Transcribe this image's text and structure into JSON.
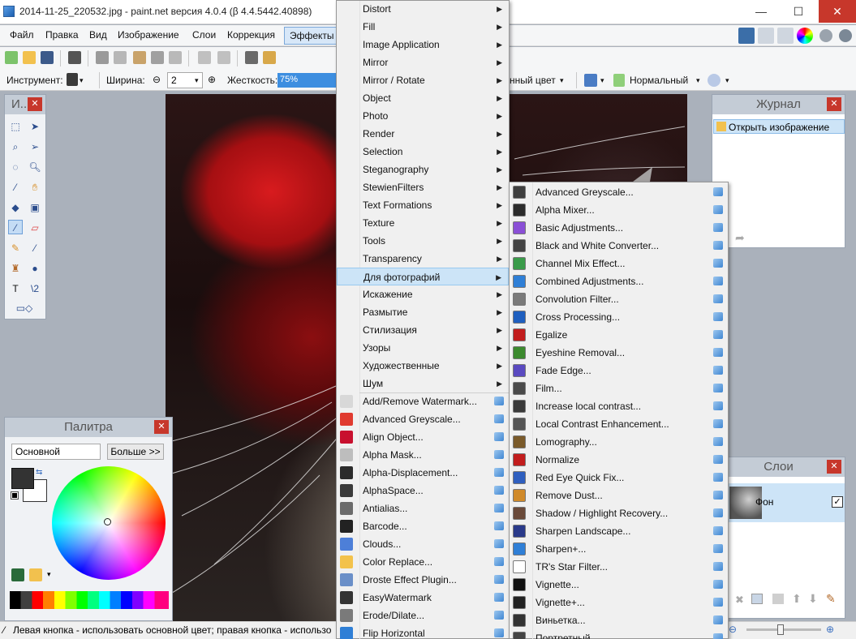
{
  "window": {
    "title": "2014-11-25_220532.jpg - paint.net версия 4.0.4 (β 4.4.5442.40898)",
    "min": "—",
    "max": "☐",
    "close": "✕"
  },
  "menubar": {
    "items": [
      "Файл",
      "Правка",
      "Вид",
      "Изображение",
      "Слои",
      "Коррекция",
      "Эффекты"
    ]
  },
  "options": {
    "instrument_label": "Инструмент:",
    "width_label": "Ширина:",
    "width_value": "2",
    "hardness_label": "Жесткость:",
    "hardness_value": "75%",
    "color_mode_tail": "нный цвет",
    "blend_mode": "Нормальный"
  },
  "tools_panel": {
    "title": "И..."
  },
  "palette_panel": {
    "title": "Палитра",
    "mode": "Основной",
    "more": "Больше >>"
  },
  "journal_panel": {
    "title": "Журнал",
    "item": "Открыть изображение"
  },
  "layers_panel": {
    "title": "Слои",
    "layer_name": "Фон"
  },
  "statusbar": {
    "text": "Левая кнопка - использовать основной цвет; правая кнопка - использо"
  },
  "effects_menu": {
    "submenus": [
      "Distort",
      "Fill",
      "Image Application",
      "Mirror",
      "Mirror / Rotate",
      "Object",
      "Photo",
      "Render",
      "Selection",
      "Steganography",
      "StewienFilters",
      "Text Formations",
      "Texture",
      "Tools",
      "Transparency",
      "Для фотографий",
      "Искажение",
      "Размытие",
      "Стилизация",
      "Узоры",
      "Художественные",
      "Шум"
    ],
    "highlighted": "Для фотографий",
    "items": [
      "Add/Remove Watermark...",
      "Advanced Greyscale...",
      "Align Object...",
      "Alpha Mask...",
      "Alpha-Displacement...",
      "AlphaSpace...",
      "Antialias...",
      "Barcode...",
      "Clouds...",
      "Color Replace...",
      "Droste Effect Plugin...",
      "EasyWatermark",
      "Erode/Dilate...",
      "Flip Horizontal"
    ],
    "item_colors": [
      "#d8d8d8",
      "#e03a2f",
      "#c8102e",
      "#bdbdbd",
      "#2b2b2b",
      "#3a3a3a",
      "#6b6b6b",
      "#222222",
      "#4d7fd8",
      "#f3c24b",
      "#6a8fc8",
      "#333333",
      "#7a7a7a",
      "#2f7fd6"
    ]
  },
  "photo_submenu": {
    "items": [
      "Advanced Greyscale...",
      "Alpha Mixer...",
      "Basic Adjustments...",
      "Black and White Converter...",
      "Channel Mix Effect...",
      "Combined Adjustments...",
      "Convolution Filter...",
      "Cross Processing...",
      "Egalize",
      "Eyeshine Removal...",
      "Fade Edge...",
      "Film...",
      "Increase local contrast...",
      "Local Contrast Enhancement...",
      "Lomography...",
      "Normalize",
      "Red Eye Quick Fix...",
      "Remove Dust...",
      "Shadow / Highlight Recovery...",
      "Sharpen Landscape...",
      "Sharpen+...",
      "TR's Star Filter...",
      "Vignette...",
      "Vignette+...",
      "Виньетка...",
      "Портретный"
    ],
    "item_colors": [
      "#3f3f3f",
      "#2b2b2b",
      "#8a4fd6",
      "#444444",
      "#3a9b4a",
      "#2f7fd6",
      "#7a7a7a",
      "#1f5fbf",
      "#c21d1d",
      "#3c8a2e",
      "#5a4ac0",
      "#4a4a4a",
      "#3a3a3a",
      "#555555",
      "#7a5a2a",
      "#c21d1d",
      "#2f5fbf",
      "#d08a2a",
      "#6a4a3a",
      "#2a3a8a",
      "#2f7fd6",
      "#ffffff",
      "#111111",
      "#222222",
      "#333333",
      "#444444"
    ]
  },
  "colors": {
    "accent": "#3d8ee0",
    "menu_highlight": "#cce4f7",
    "panel_header": "#c4ccd6",
    "close_red": "#c7372b"
  }
}
